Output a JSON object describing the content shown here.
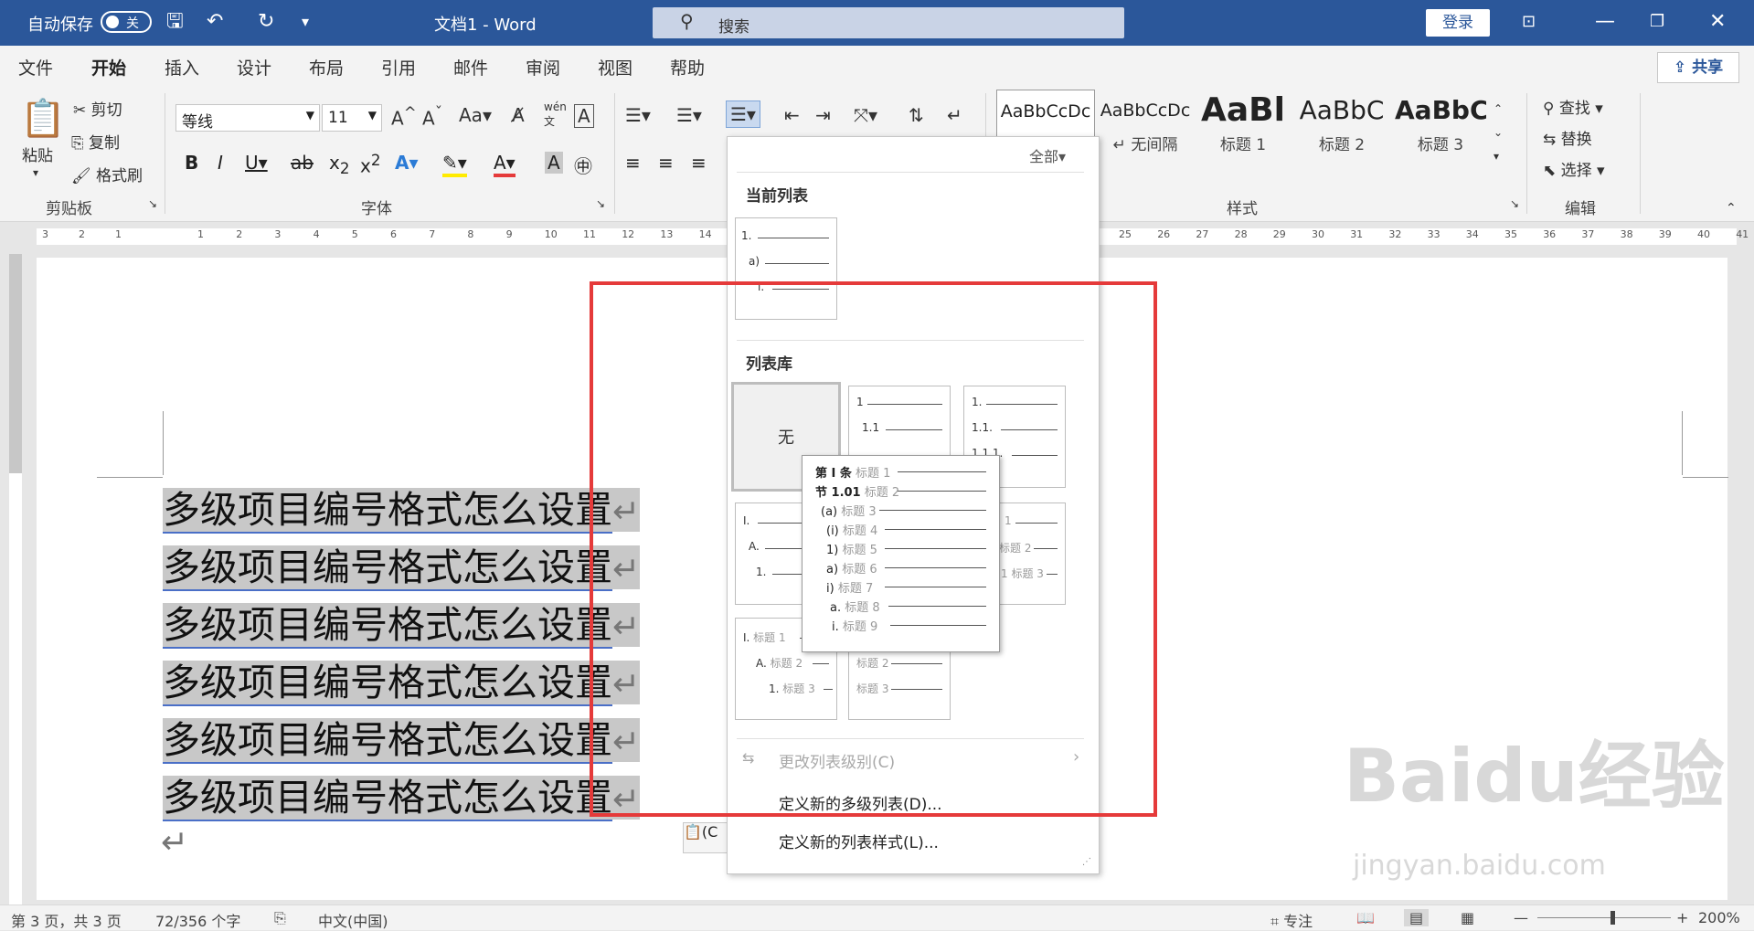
{
  "titlebar": {
    "autosave_label": "自动保存",
    "autosave_state": "关",
    "doc_title": "文档1  -  Word",
    "search_placeholder": "搜索",
    "login": "登录"
  },
  "tabs": [
    "文件",
    "开始",
    "插入",
    "设计",
    "布局",
    "引用",
    "邮件",
    "审阅",
    "视图",
    "帮助"
  ],
  "share": "共享",
  "ribbon": {
    "clipboard": {
      "paste": "粘贴",
      "cut": "剪切",
      "copy": "复制",
      "format_painter": "格式刷",
      "label": "剪贴板"
    },
    "font": {
      "name": "等线",
      "size": "11",
      "label": "字体"
    },
    "styles": {
      "items": [
        {
          "sample": "AaBbCcDc",
          "name": ""
        },
        {
          "sample": "AaBbCcDc",
          "name": "↵ 无间隔"
        },
        {
          "sample": "AaBl",
          "name": "标题 1"
        },
        {
          "sample": "AaBbC",
          "name": "标题 2"
        },
        {
          "sample": "AaBbC",
          "name": "标题 3"
        }
      ],
      "label": "样式"
    },
    "editing": {
      "find": "查找",
      "replace": "替换",
      "select": "选择",
      "label": "编辑"
    }
  },
  "ruler": {
    "left_ticks": [
      "3",
      "2",
      "1"
    ],
    "ticks": [
      "1",
      "2",
      "3",
      "4",
      "5",
      "6",
      "7",
      "8",
      "9",
      "10",
      "11",
      "12",
      "13",
      "14",
      "25",
      "26",
      "27",
      "28",
      "29",
      "30",
      "31",
      "32",
      "33",
      "34",
      "35",
      "36",
      "37",
      "38",
      "39",
      "40",
      "41"
    ]
  },
  "document": {
    "lines": [
      "多级项目编号格式怎么设置",
      "多级项目编号格式怎么设置",
      "多级项目编号格式怎么设置",
      "多级项目编号格式怎么设置",
      "多级项目编号格式怎么设置",
      "多级项目编号格式怎么设置"
    ],
    "para_mark": "↵",
    "paste_label": "(C"
  },
  "dropdown": {
    "filter": "全部▾",
    "current_list_heading": "当前列表",
    "library_heading": "列表库",
    "none_label": "无",
    "change_level": "更改列表级别(C)",
    "define_multilevel": "定义新的多级列表(D)...",
    "define_style": "定义新的列表样式(L)..."
  },
  "preview": {
    "rows": [
      {
        "num": "第 Ⅰ 条",
        "label": "标题 1"
      },
      {
        "num": "节 1.01",
        "label": "标题 2"
      },
      {
        "num": "(a)",
        "label": "标题 3"
      },
      {
        "num": "(i)",
        "label": "标题 4"
      },
      {
        "num": "1)",
        "label": "标题 5"
      },
      {
        "num": "a)",
        "label": "标题 6"
      },
      {
        "num": "i)",
        "label": "标题 7"
      },
      {
        "num": "a.",
        "label": "标题 8"
      },
      {
        "num": "i.",
        "label": "标题 9"
      }
    ]
  },
  "statusbar": {
    "page": "第 3 页，共 3 页",
    "words": "72/356 个字",
    "lang": "中文(中国)",
    "focus": "专注",
    "zoom": "200%"
  },
  "watermark": {
    "brand": "Baidu经验",
    "url": "jingyan.baidu.com"
  },
  "colors": {
    "accent": "#2b579a",
    "highlight_box": "#e53a3a",
    "selection": "#c8c8c8"
  }
}
